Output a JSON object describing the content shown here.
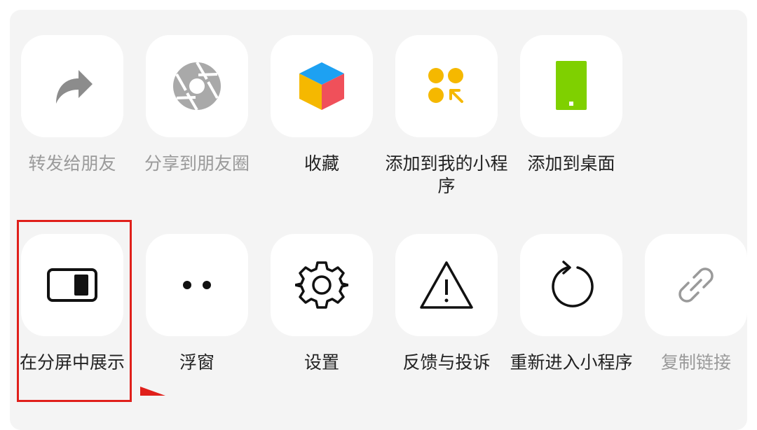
{
  "row1": [
    {
      "label": "转发给朋友",
      "dim": true,
      "icon": "forward-arrow-icon"
    },
    {
      "label": "分享到朋友圈",
      "dim": true,
      "icon": "moments-shutter-icon"
    },
    {
      "label": "收藏",
      "dim": false,
      "icon": "favorite-cube-icon"
    },
    {
      "label": "添加到我的小程序",
      "dim": false,
      "icon": "add-mini-program-icon"
    },
    {
      "label": "添加到桌面",
      "dim": false,
      "icon": "add-to-desktop-icon"
    }
  ],
  "row2": [
    {
      "label": "在分屏中展示",
      "dim": false,
      "icon": "split-screen-icon"
    },
    {
      "label": "浮窗",
      "dim": false,
      "icon": "floating-window-icon"
    },
    {
      "label": "设置",
      "dim": false,
      "icon": "gear-icon"
    },
    {
      "label": "反馈与投诉",
      "dim": false,
      "icon": "warning-triangle-icon"
    },
    {
      "label": "重新进入小程序",
      "dim": false,
      "icon": "refresh-icon"
    },
    {
      "label": "复制链接",
      "dim": true,
      "icon": "link-icon"
    }
  ],
  "colors": {
    "highlight": "#e0201b",
    "sheet": "#f4f4f4",
    "dim_text": "#9a9a9a"
  }
}
